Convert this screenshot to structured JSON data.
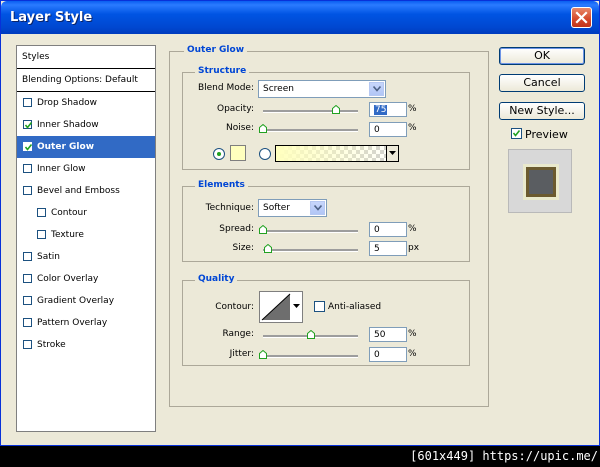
{
  "window": {
    "title": "Layer Style"
  },
  "sidebar": {
    "header": "Styles",
    "blending": "Blending Options: Default",
    "items": [
      {
        "label": "Drop Shadow",
        "checked": false
      },
      {
        "label": "Inner Shadow",
        "checked": true
      },
      {
        "label": "Outer Glow",
        "checked": true,
        "selected": true
      },
      {
        "label": "Inner Glow",
        "checked": false
      },
      {
        "label": "Bevel and Emboss",
        "checked": false
      },
      {
        "label": "Contour",
        "checked": false,
        "indent": true
      },
      {
        "label": "Texture",
        "checked": false,
        "indent": true
      },
      {
        "label": "Satin",
        "checked": false
      },
      {
        "label": "Color Overlay",
        "checked": false
      },
      {
        "label": "Gradient Overlay",
        "checked": false
      },
      {
        "label": "Pattern Overlay",
        "checked": false
      },
      {
        "label": "Stroke",
        "checked": false
      }
    ]
  },
  "panel": {
    "title": "Outer Glow",
    "structure": {
      "title": "Structure",
      "blend_mode_label": "Blend Mode:",
      "blend_mode": "Screen",
      "opacity_label": "Opacity:",
      "opacity": "75",
      "noise_label": "Noise:",
      "noise": "0",
      "percent": "%",
      "glow_color": "#ffffbe"
    },
    "elements": {
      "title": "Elements",
      "technique_label": "Technique:",
      "technique": "Softer",
      "spread_label": "Spread:",
      "spread": "0",
      "size_label": "Size:",
      "size": "5",
      "percent": "%",
      "px": "px"
    },
    "quality": {
      "title": "Quality",
      "contour_label": "Contour:",
      "anti_aliased": "Anti-aliased",
      "range_label": "Range:",
      "range": "50",
      "jitter_label": "Jitter:",
      "jitter": "0",
      "percent": "%"
    }
  },
  "buttons": {
    "ok": "OK",
    "cancel": "Cancel",
    "new_style": "New Style...",
    "preview": "Preview",
    "preview_checked": true
  },
  "footer": {
    "text": "[601x449] https://upic.me/"
  },
  "colors": {
    "accent": "#0046d5",
    "selection": "#316ac5",
    "titlebar": "#0054e3"
  }
}
